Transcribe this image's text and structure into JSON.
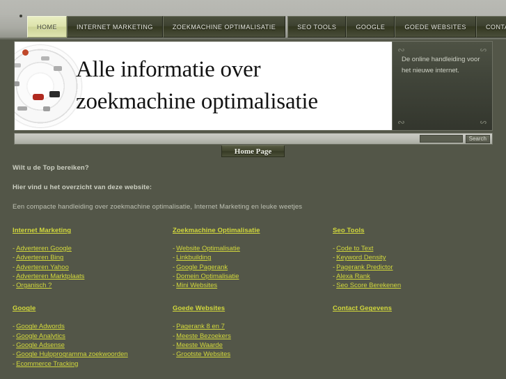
{
  "nav": {
    "items": [
      {
        "label": "HOME",
        "active": true
      },
      {
        "label": "INTERNET MARKETING",
        "active": false
      },
      {
        "label": "ZOEKMACHINE OPTIMALISATIE",
        "active": false
      },
      {
        "label": "SEO TOOLS",
        "active": false
      },
      {
        "label": "GOOGLE",
        "active": false
      },
      {
        "label": "GOEDE WEBSITES",
        "active": false
      },
      {
        "label": "CONTACT ADRES",
        "active": false
      }
    ]
  },
  "banner": {
    "heading_line1": "Alle informatie over",
    "heading_line2": "zoekmachine optimalisatie",
    "sidebox_text": "De online handleiding voor het nieuwe internet."
  },
  "search": {
    "value": "",
    "placeholder": "",
    "button_label": "Search"
  },
  "homepage_button": {
    "label": "Home Page"
  },
  "intro": {
    "line1": "Wilt u de Top bereiken?",
    "line2": "Hier vind u het overzicht van deze website:",
    "line3": "Een compacte handleiding over zoekmachine optimalisatie, Internet Marketing en leuke weetjes"
  },
  "columns": [
    {
      "title": "Internet Marketing",
      "links": [
        "Adverteren Google",
        "Adverteren Bing",
        "Adverteren Yahoo",
        "Adverteren Marktplaats",
        "Organisch ?"
      ]
    },
    {
      "title": "Zoekmachine Optimalisatie",
      "links": [
        "Website Optimalisatie",
        "Linkbuilding",
        "Google Pagerank",
        "Domein Optimalisatie",
        "Mini Websites"
      ]
    },
    {
      "title": "Seo Tools",
      "links": [
        "Code to Text",
        "Keyword Density",
        "Pagerank Predictor",
        "Alexa Rank",
        "Seo Score Berekenen"
      ]
    },
    {
      "title": "Google",
      "links": [
        "Google Adwords",
        "Google Analytics",
        "Google Adsense",
        "Google Hulpprogramma zoekwoorden",
        "Ecommerce Tracking"
      ]
    },
    {
      "title": "Goede Websites",
      "links": [
        "Pagerank 8 en 7",
        "Meeste Bezoekers",
        "Meeste Waarde",
        "Grootste Websites"
      ]
    },
    {
      "title": "Contact Gegevens",
      "links": []
    }
  ],
  "colors": {
    "page_background": "#535648",
    "link": "#d2d83c",
    "active_tab": "#dde3ac",
    "nav_tab": "#3e4231"
  },
  "bullet_marker": "•"
}
